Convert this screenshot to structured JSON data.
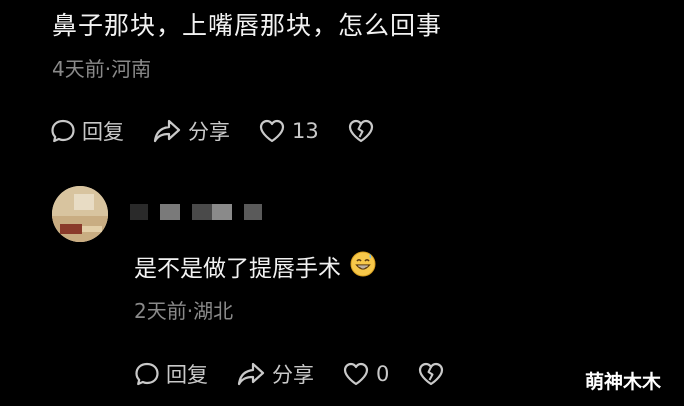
{
  "comment": {
    "text": "鼻子那块，上嘴唇那块，怎么回事",
    "meta": "4天前·河南",
    "actions": {
      "reply_label": "回复",
      "share_label": "分享",
      "like_count": "13"
    }
  },
  "reply": {
    "username": "",
    "text": "是不是做了提唇手术",
    "emoji": "grinning-sweat-emoji",
    "meta": "2天前·湖北",
    "actions": {
      "reply_label": "回复",
      "share_label": "分享",
      "like_count": "0"
    }
  },
  "watermark": "萌神木木",
  "icons": {
    "reply": "comment-bubble-icon",
    "share": "share-arrow-icon",
    "like": "heart-icon",
    "dislike": "broken-heart-icon"
  },
  "colors": {
    "background": "#000000",
    "text": "#f2f2f2",
    "meta": "#8a8a8a",
    "icon": "#c9c9c9"
  }
}
